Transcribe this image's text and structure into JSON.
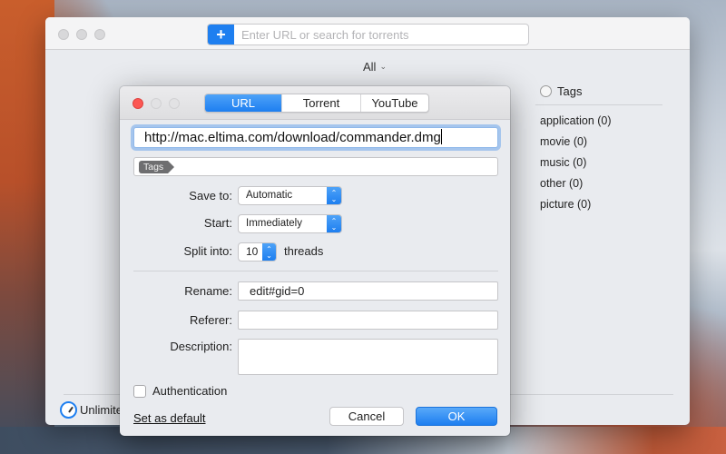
{
  "main_window": {
    "search": {
      "add_icon": "plus-icon",
      "placeholder": "Enter URL or search for torrents",
      "value": ""
    },
    "filter": {
      "label": "All",
      "icon": "chevron-down-icon"
    },
    "tags_panel": {
      "header": "Tags",
      "items": [
        {
          "label": "application (0)"
        },
        {
          "label": "movie (0)"
        },
        {
          "label": "music (0)"
        },
        {
          "label": "other (0)"
        },
        {
          "label": "picture (0)"
        }
      ]
    },
    "speed_limit": {
      "icon": "gauge-icon",
      "label": "Unlimited"
    }
  },
  "dialog": {
    "tabs": [
      {
        "label": "URL",
        "active": true
      },
      {
        "label": "Torrent",
        "active": false
      },
      {
        "label": "YouTube",
        "active": false
      }
    ],
    "url_value": "http://mac.eltima.com/download/commander.dmg",
    "tags_chip": "Tags",
    "save_to": {
      "label": "Save to:",
      "value": "Automatic"
    },
    "start": {
      "label": "Start:",
      "value": "Immediately"
    },
    "split": {
      "label": "Split into:",
      "value": "10",
      "suffix": "threads"
    },
    "rename": {
      "label": "Rename:",
      "value": "edit#gid=0"
    },
    "referer": {
      "label": "Referer:",
      "value": ""
    },
    "description": {
      "label": "Description:",
      "value": ""
    },
    "authentication": {
      "label": "Authentication",
      "checked": false
    },
    "set_default": "Set as default",
    "cancel": "Cancel",
    "ok": "OK"
  },
  "colors": {
    "accent": "#1e7ff0",
    "close_red": "#fc5753",
    "window_bg": "#e9ebef"
  }
}
